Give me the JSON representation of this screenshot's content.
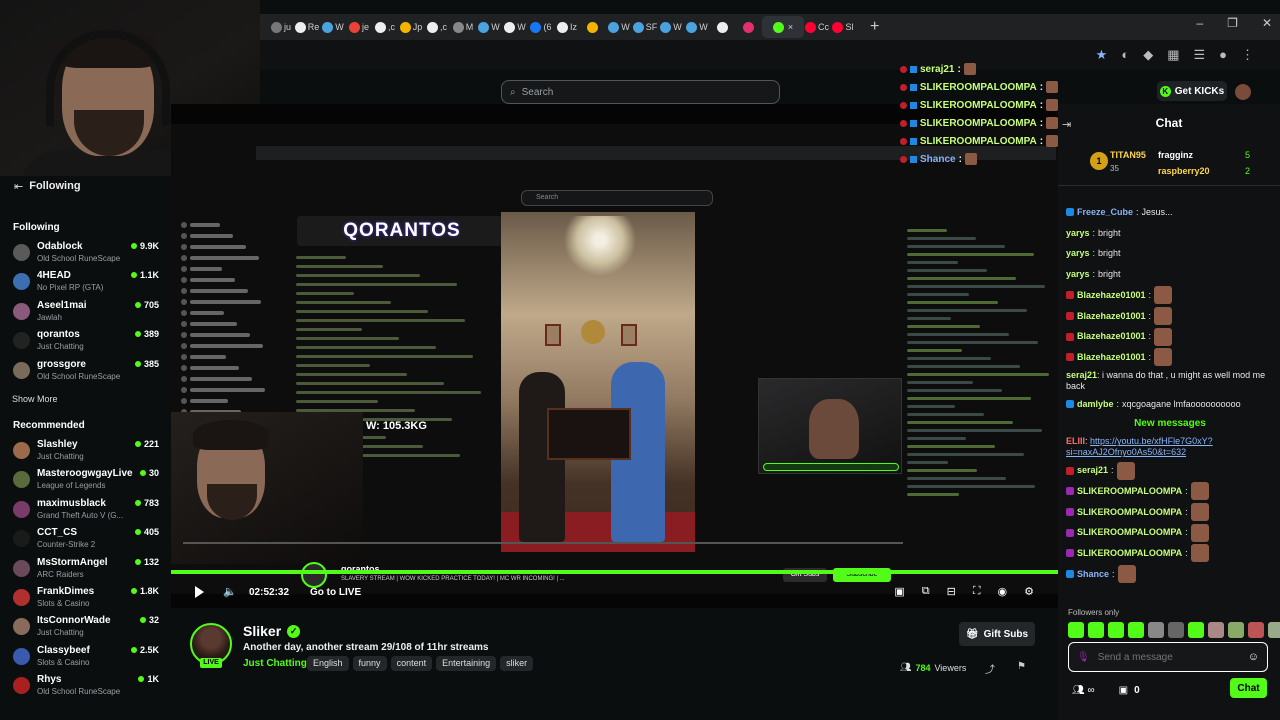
{
  "browser": {
    "new_tab": "+",
    "tabs": [
      {
        "label": "ju",
        "color": "#777"
      },
      {
        "label": "Re",
        "color": "#eee"
      },
      {
        "label": "W",
        "color": "#4aa3df"
      },
      {
        "label": "je",
        "color": "#ea4335"
      },
      {
        "label": ",c",
        "color": "#eee"
      },
      {
        "label": "Jp",
        "color": "#f4b400"
      },
      {
        "label": ",c",
        "color": "#eee"
      },
      {
        "label": "M",
        "color": "#888"
      },
      {
        "label": "W",
        "color": "#4aa3df"
      },
      {
        "label": "W",
        "color": "#eee"
      },
      {
        "label": "(6",
        "color": "#1877f2"
      },
      {
        "label": "Iz",
        "color": "#eee"
      },
      {
        "label": "",
        "color": "#f4b400"
      },
      {
        "label": "W",
        "color": "#4aa3df"
      },
      {
        "label": "SF",
        "color": "#4aa3df"
      },
      {
        "label": "W",
        "color": "#4aa3df"
      },
      {
        "label": "W",
        "color": "#4aa3df"
      },
      {
        "label": "",
        "color": "#eee"
      },
      {
        "label": "",
        "color": "#e1306c"
      },
      {
        "label": "",
        "color": "#53fc18",
        "active": true
      },
      {
        "label": "Cc",
        "color": "#ff0033"
      },
      {
        "label": "Sl",
        "color": "#ff0033"
      }
    ]
  },
  "header": {
    "search_placeholder": "Search",
    "get_kicks": "Get KICKs"
  },
  "overlay_chat": [
    {
      "user": "seraj21",
      "color": "#c7ff7a"
    },
    {
      "user": "SLIKEROOMPALOOMPA",
      "color": "#c7ff7a"
    },
    {
      "user": "SLIKEROOMPALOOMPA",
      "color": "#c7ff7a"
    },
    {
      "user": "SLIKEROOMPALOOMPA",
      "color": "#c7ff7a"
    },
    {
      "user": "SLIKEROOMPALOOMPA",
      "color": "#c7ff7a"
    },
    {
      "user": "Shance",
      "color": "#8ab4f8"
    }
  ],
  "sidebar": {
    "top_label": "Following",
    "following_heading": "Following",
    "recommended_heading": "Recommended",
    "show_more": "Show More",
    "following": [
      {
        "name": "Odablock",
        "category": "Old School RuneScape",
        "viewers": "9.9K",
        "avatar": "#5a5a5a"
      },
      {
        "name": "4HEAD",
        "category": "No Pixel RP (GTA)",
        "viewers": "1.1K",
        "avatar": "#3c6fb0"
      },
      {
        "name": "Aseel1mai",
        "category": "Jawlah",
        "viewers": "705",
        "avatar": "#8a5a7a"
      },
      {
        "name": "qorantos",
        "category": "Just Chatting",
        "viewers": "389",
        "avatar": "#222"
      },
      {
        "name": "grossgore",
        "category": "Old School RuneScape",
        "viewers": "385",
        "avatar": "#7a6a5a"
      }
    ],
    "recommended": [
      {
        "name": "Slashley",
        "category": "Just Chatting",
        "viewers": "221",
        "avatar": "#9a6a4a"
      },
      {
        "name": "MasteroogwgayLive",
        "category": "League of Legends",
        "viewers": "30",
        "avatar": "#5a6a3a"
      },
      {
        "name": "maximusblack",
        "category": "Grand Theft Auto V (G...",
        "viewers": "783",
        "avatar": "#7a3a6a"
      },
      {
        "name": "CCT_CS",
        "category": "Counter-Strike 2",
        "viewers": "405",
        "avatar": "#1a1a1a"
      },
      {
        "name": "MsStormAngel",
        "category": "ARC Raiders",
        "viewers": "132",
        "avatar": "#6a4a5a"
      },
      {
        "name": "FrankDimes",
        "category": "Slots & Casino",
        "viewers": "1.8K",
        "avatar": "#b03030"
      },
      {
        "name": "ItsConnorWade",
        "category": "Just Chatting",
        "viewers": "32",
        "avatar": "#8a6a5a"
      },
      {
        "name": "Classybeef",
        "category": "Slots & Casino",
        "viewers": "2.5K",
        "avatar": "#3a5ab0"
      },
      {
        "name": "Rhys",
        "category": "Old School RuneScape",
        "viewers": "1K",
        "avatar": "#aa2020"
      }
    ]
  },
  "video": {
    "inner_search": "Search",
    "inner_logo": "QORANTOS",
    "inner_streamer": "qorantos",
    "inner_title": "SLAVERY STREAM | WOW KICKED PRACTICE TODAY! | MC WR INCOMING! | ...",
    "inner_gift": "Gift Subs",
    "inner_subscribe": "Subscribe",
    "weight_text": "W: 105.3KG",
    "progress_fraction": 1.0
  },
  "controls": {
    "time": "02:52:32",
    "go_live": "Go to LIVE",
    "volume_icon": "🔈",
    "right_icons": [
      "▣",
      "⧉",
      "⊟",
      "⛶",
      "◉",
      "⚙"
    ]
  },
  "stream": {
    "streamer": "Sliker",
    "live": "LIVE",
    "title": "Another day, another stream 29/108 of 11hr streams",
    "category": "Just Chatting",
    "tags": [
      "English",
      "funny",
      "content",
      "Entertaining",
      "sliker"
    ],
    "gift_subs": "Gift Subs",
    "viewers_count": "784",
    "viewers_label": "Viewers"
  },
  "chat": {
    "title": "Chat",
    "leaderboard": {
      "first_name": "TITAN95",
      "first_value": "35",
      "second_name": "fragginz",
      "second_value": "5",
      "third_name": "raspberry20",
      "third_value": "2"
    },
    "messages_before": [
      {
        "user": "Freeze_Cube",
        "text": "Jesus...",
        "color": "#8ab4f8",
        "badge": "#1e88e5"
      },
      {
        "user": "yarys",
        "text": "bright",
        "color": "#c7ff7a",
        "badge": ""
      },
      {
        "user": "yarys",
        "text": "bright",
        "color": "#c7ff7a",
        "badge": ""
      },
      {
        "user": "yarys",
        "text": "bright",
        "color": "#c7ff7a",
        "badge": ""
      },
      {
        "user": "Blazehaze01001",
        "text": "",
        "color": "#c7ff7a",
        "badge": "#c21f2b",
        "emote": true
      },
      {
        "user": "Blazehaze01001",
        "text": "",
        "color": "#c7ff7a",
        "badge": "#c21f2b",
        "emote": true
      },
      {
        "user": "Blazehaze01001",
        "text": "",
        "color": "#c7ff7a",
        "badge": "#c21f2b",
        "emote": true
      },
      {
        "user": "Blazehaze01001",
        "text": "",
        "color": "#c7ff7a",
        "badge": "#c21f2b",
        "emote": true
      }
    ],
    "wrap_msg_1": {
      "user": "seraj21",
      "text": "i wanna do that , u might as well mod me back"
    },
    "msg_damly": {
      "user": "damlybe",
      "text": "xqcgoagane lmfaoooooooooo"
    },
    "new_messages": "New messages",
    "wrap_msg_2": {
      "user": "ELIII",
      "link": "https://youtu.be/xfHFle7G0xY?si=naxAJ2Ofnyo0As50&t=632"
    },
    "messages_after": [
      {
        "user": "seraj21",
        "text": "",
        "color": "#c7ff7a",
        "badge": "#c21f2b",
        "emote": true
      },
      {
        "user": "SLIKEROOMPALOOMPA",
        "text": "",
        "color": "#c7ff7a",
        "badge": "#9c27b0",
        "emote": true
      },
      {
        "user": "SLIKEROOMPALOOMPA",
        "text": "",
        "color": "#c7ff7a",
        "badge": "#9c27b0",
        "emote": true
      },
      {
        "user": "SLIKEROOMPALOOMPA",
        "text": "",
        "color": "#c7ff7a",
        "badge": "#9c27b0",
        "emote": true
      },
      {
        "user": "SLIKEROOMPALOOMPA",
        "text": "",
        "color": "#c7ff7a",
        "badge": "#9c27b0",
        "emote": true
      },
      {
        "user": "Shance",
        "text": "",
        "color": "#8ab4f8",
        "badge": "#1e88e5",
        "emote": true
      }
    ],
    "followers_only": "Followers only",
    "input_placeholder": "Send a message",
    "kicks_count": "0",
    "send": "Chat"
  },
  "colors": {
    "accent": "#53fc18",
    "background": "#0b0e0f"
  }
}
